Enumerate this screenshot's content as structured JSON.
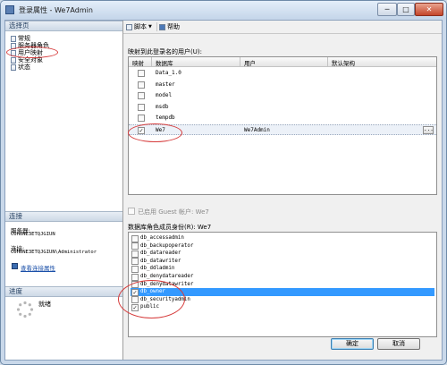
{
  "window": {
    "title": "登录属性 - We7Admin",
    "min": "─",
    "max": "□",
    "close": "✕"
  },
  "left": {
    "select_page_header": "选择页",
    "pages": [
      {
        "label": "常规",
        "icon": "page-icon"
      },
      {
        "label": "服务器角色",
        "icon": "page-icon"
      },
      {
        "label": "用户映射",
        "icon": "page-icon"
      },
      {
        "label": "安全对象",
        "icon": "page-icon"
      },
      {
        "label": "状态",
        "icon": "page-icon"
      }
    ],
    "connection_header": "连接",
    "server_label": "服务器:",
    "server_value": "CUHONE3ETQJGIUN",
    "conn_label": "连接:",
    "conn_value": "CUHONE3ETQJGIUN\\Administrator",
    "view_conn_props": "查看连接属性",
    "progress_header": "进度",
    "progress_status": "就绪"
  },
  "toolbar": {
    "script": "脚本",
    "help": "帮助"
  },
  "mapping": {
    "label": "映射到此登录名的用户(U):",
    "columns": [
      "映射",
      "数据库",
      "用户",
      "默认架构"
    ],
    "rows": [
      {
        "checked": false,
        "db": "Data_1.0",
        "user": "",
        "schema": ""
      },
      {
        "checked": false,
        "db": "master",
        "user": "",
        "schema": ""
      },
      {
        "checked": false,
        "db": "model",
        "user": "",
        "schema": ""
      },
      {
        "checked": false,
        "db": "msdb",
        "user": "",
        "schema": ""
      },
      {
        "checked": false,
        "db": "tempdb",
        "user": "",
        "schema": ""
      },
      {
        "checked": true,
        "db": "We7",
        "user": "We7Admin",
        "schema": ""
      }
    ],
    "ellipsis": "..."
  },
  "guest_label": "已启用 Guest 帐户: We7",
  "roles": {
    "label": "数据库角色成员身份(R): We7",
    "items": [
      {
        "name": "db_accessadmin",
        "checked": false
      },
      {
        "name": "db_backupoperator",
        "checked": false
      },
      {
        "name": "db_datareader",
        "checked": false
      },
      {
        "name": "db_datawriter",
        "checked": false
      },
      {
        "name": "db_ddladmin",
        "checked": false
      },
      {
        "name": "db_denydatareader",
        "checked": false
      },
      {
        "name": "db_denydatawriter",
        "checked": false
      },
      {
        "name": "db_owner",
        "checked": true
      },
      {
        "name": "db_securityadmin",
        "checked": false
      },
      {
        "name": "public",
        "checked": true
      }
    ]
  },
  "buttons": {
    "ok": "确定",
    "cancel": "取消"
  },
  "colors": {
    "highlight": "#3399ff",
    "annotation_ring": "#d63b3b"
  }
}
